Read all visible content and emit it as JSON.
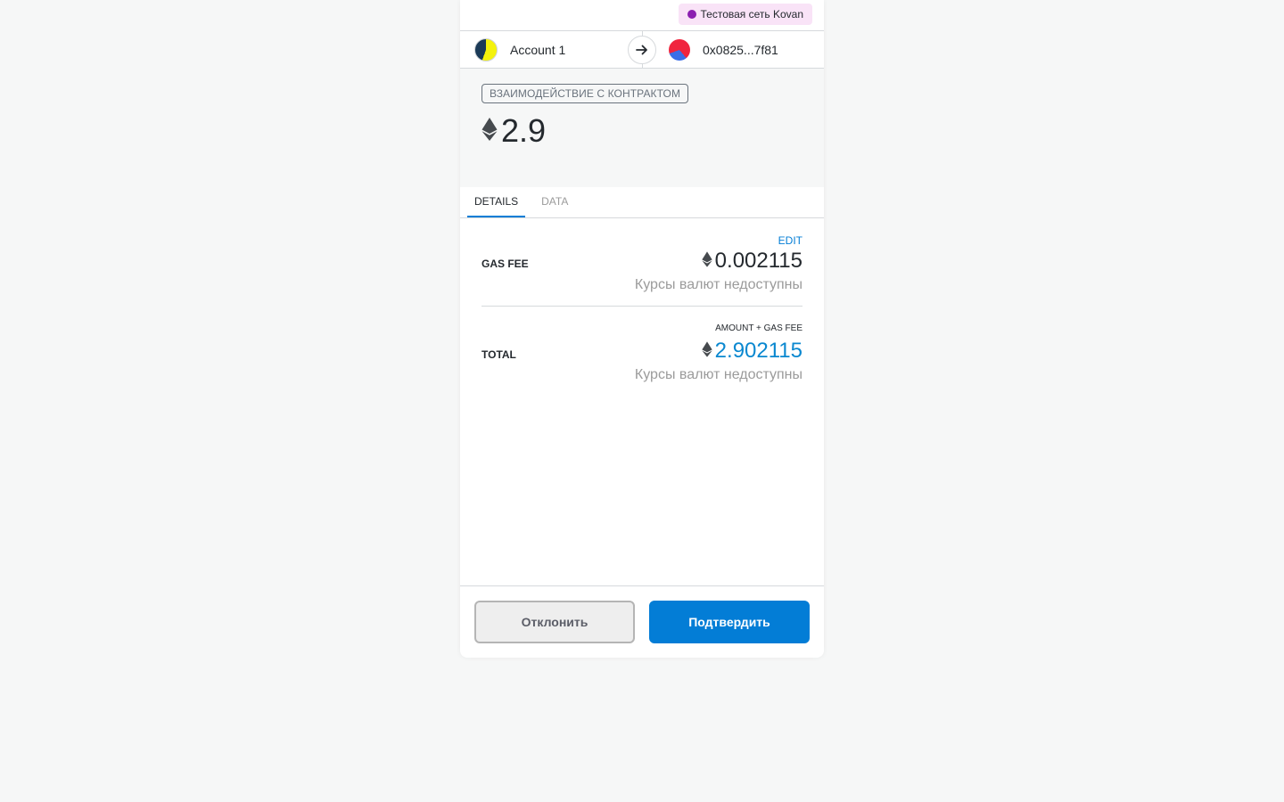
{
  "network": {
    "label": "Тестовая сеть Kovan",
    "dot_color": "#8b1fb0"
  },
  "sender": {
    "name": "Account 1",
    "avatar_icon": "identicon"
  },
  "recipient": {
    "address": "0x0825...7f81",
    "avatar_icon": "identicon"
  },
  "summary": {
    "action": "ВЗАИМОДЕЙСТВИЕ С КОНТРАКТОМ",
    "amount": "2.9",
    "currency_icon": "eth-icon"
  },
  "tabs": [
    {
      "label": "DETAILS",
      "active": true
    },
    {
      "label": "DATA",
      "active": false
    }
  ],
  "details": {
    "edit_label": "EDIT",
    "gas_fee": {
      "label": "GAS FEE",
      "value": "0.002115",
      "fiat": "Курсы валют недоступны"
    },
    "total": {
      "sub_heading": "AMOUNT + GAS FEE",
      "label": "TOTAL",
      "value": "2.902115",
      "fiat": "Курсы валют недоступны",
      "value_color": "#0a88d0"
    }
  },
  "footer": {
    "reject_label": "Отклонить",
    "confirm_label": "Подтвердить",
    "confirm_color": "#037dd6"
  }
}
